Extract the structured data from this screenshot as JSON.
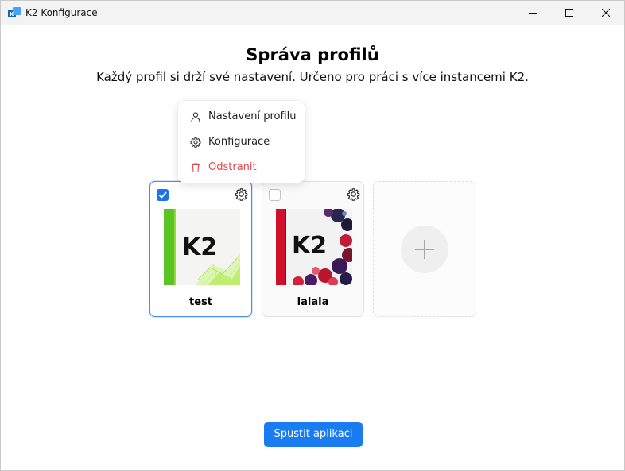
{
  "window": {
    "title": "K2 Konfigurace"
  },
  "page": {
    "heading": "Správa profilů",
    "subtitle": "Každý profil si drží své nastavení. Určeno pro práci s více instancemi K2."
  },
  "context_menu": {
    "items": [
      {
        "label": "Nastavení profilu",
        "icon": "user-icon"
      },
      {
        "label": "Konfigurace",
        "icon": "gear-icon"
      },
      {
        "label": "Odstranit",
        "icon": "trash-icon",
        "color": "#e5484d"
      }
    ]
  },
  "profiles": [
    {
      "name": "test",
      "selected": true,
      "logo_text": "K2",
      "theme": "green"
    },
    {
      "name": "lalala",
      "selected": false,
      "logo_text": "K2",
      "theme": "red-berries"
    }
  ],
  "add_profile": {
    "icon": "plus-icon"
  },
  "actions": {
    "launch_label": "Spustit aplikaci"
  },
  "colors": {
    "accent": "#1a7cf2",
    "danger": "#e5484d",
    "selected_border": "#4a8df6"
  }
}
